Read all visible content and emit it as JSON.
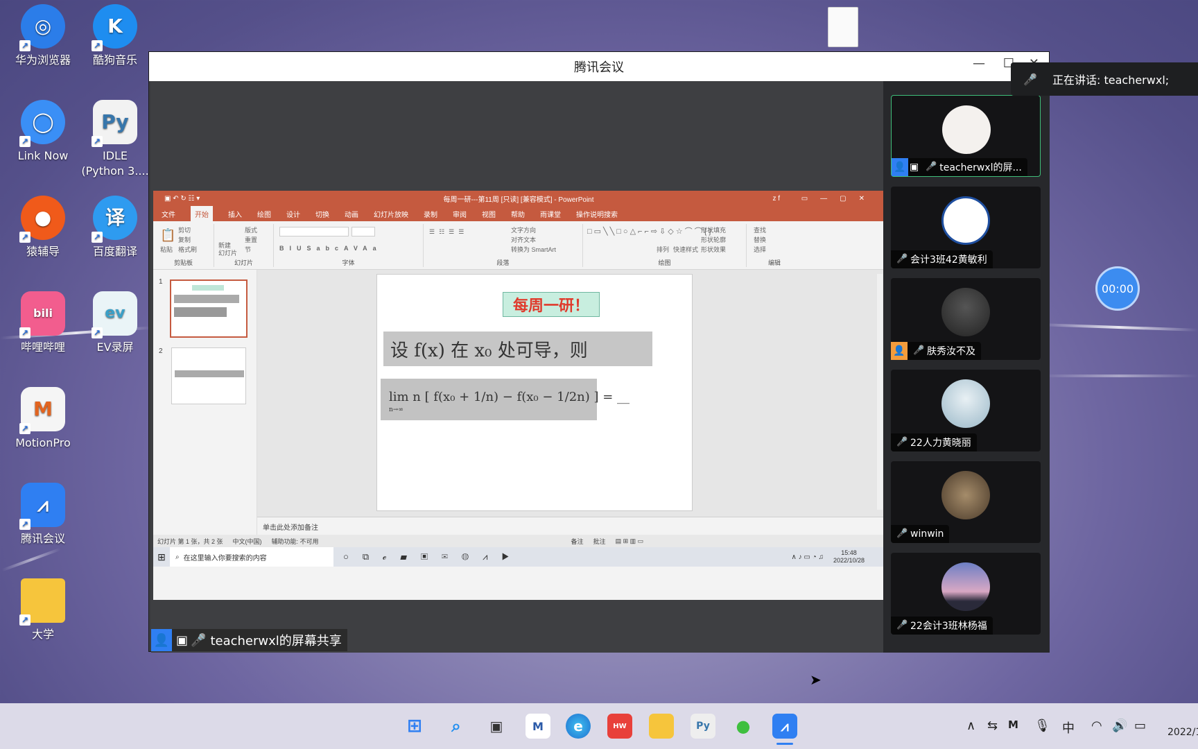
{
  "desktop": {
    "icons": [
      {
        "label": "华为浏览器",
        "icon": "huawei-browser-icon"
      },
      {
        "label": "酷狗音乐",
        "icon": "kugou-music-icon"
      },
      {
        "label": "Link Now",
        "icon": "link-now-icon"
      },
      {
        "label": "IDLE\n(Python 3....",
        "icon": "python-idle-icon"
      },
      {
        "label": "猿辅导",
        "icon": "yuanfudao-icon"
      },
      {
        "label": "百度翻译",
        "icon": "baidu-translate-icon"
      },
      {
        "label": "哔哩哔哩",
        "icon": "bilibili-icon"
      },
      {
        "label": "EV录屏",
        "icon": "ev-recorder-icon"
      },
      {
        "label": "MotionPro",
        "icon": "motionpro-icon"
      },
      {
        "label": "腾讯会议",
        "icon": "tencent-meeting-icon"
      },
      {
        "label": "大学",
        "icon": "folder-icon"
      }
    ]
  },
  "meeting": {
    "title": "腾讯会议",
    "speaking_label": "正在讲话: teacherwxl;",
    "timer": "00:00",
    "share_label": "teacherwxl的屏幕共享",
    "participants": [
      {
        "name": "teacherwxl的屏...",
        "avatar": "couple-cartoon-avatar",
        "active": true
      },
      {
        "name": "会计3班42黄敏利",
        "avatar": "zju-logo-avatar",
        "active": false
      },
      {
        "name": "肤秀汝不及",
        "avatar": "person-avatar",
        "active": false
      },
      {
        "name": "22人力黄晓丽",
        "avatar": "girl-photo-avatar",
        "active": false
      },
      {
        "name": "winwin",
        "avatar": "book-photo-avatar",
        "active": false
      },
      {
        "name": "22会计3班林杨福",
        "avatar": "sunset-avatar",
        "active": false
      }
    ]
  },
  "ppt": {
    "title": "每周一研---第11周 [只读] [兼容模式] - PowerPoint",
    "user": "z f",
    "tabs": [
      "文件",
      "开始",
      "插入",
      "绘图",
      "设计",
      "切换",
      "动画",
      "幻灯片放映",
      "录制",
      "审阅",
      "视图",
      "帮助",
      "雨课堂",
      "操作说明搜索"
    ],
    "active_tab": "开始",
    "groups": [
      "剪贴板",
      "幻灯片",
      "字体",
      "段落",
      "绘图",
      "编辑"
    ],
    "ribbon": {
      "paste": "粘贴",
      "cut": "剪切",
      "copy": "复制",
      "format_painter": "格式刷",
      "new_slide": "新建\n幻灯片",
      "layout": "版式",
      "reset": "重置",
      "section": "节",
      "text_direction": "文字方向",
      "align_text": "对齐文本",
      "smartart": "转换为 SmartArt",
      "arrange": "排列",
      "quick_styles": "快速样式",
      "shape_fill": "形状填充",
      "shape_outline": "形状轮廓",
      "shape_effects": "形状效果",
      "find": "查找",
      "replace": "替换",
      "select": "选择"
    },
    "slides": [
      "1",
      "2"
    ],
    "slide_heading": "每周一研！",
    "slide_line1": "设 f(x) 在 x₀ 处可导，则",
    "slide_formula": "lim n [ f(x₀ + 1/n) − f(x₀ − 1/2n) ] = __",
    "slide_formula_sub": "n→∞",
    "notes_placeholder": "单击此处添加备注",
    "status": {
      "slide_info": "幻灯片 第 1 张，共 2 张",
      "lang": "中文(中国)",
      "accessibility": "辅助功能: 不可用",
      "notes": "备注",
      "comments": "批注"
    },
    "inner_taskbar": {
      "search": "在这里输入你要搜索的内容",
      "time": "15:48",
      "date": "2022/10/28"
    }
  },
  "taskbar": {
    "ime": "中",
    "date": "2022/1"
  },
  "colors": {
    "ppt_accent": "#c55a3f",
    "meeting_blue": "#3c8cf0",
    "active_border": "#3fbf7a",
    "mic_muted": "#e04848",
    "mic_on": "#3fcf5f"
  }
}
